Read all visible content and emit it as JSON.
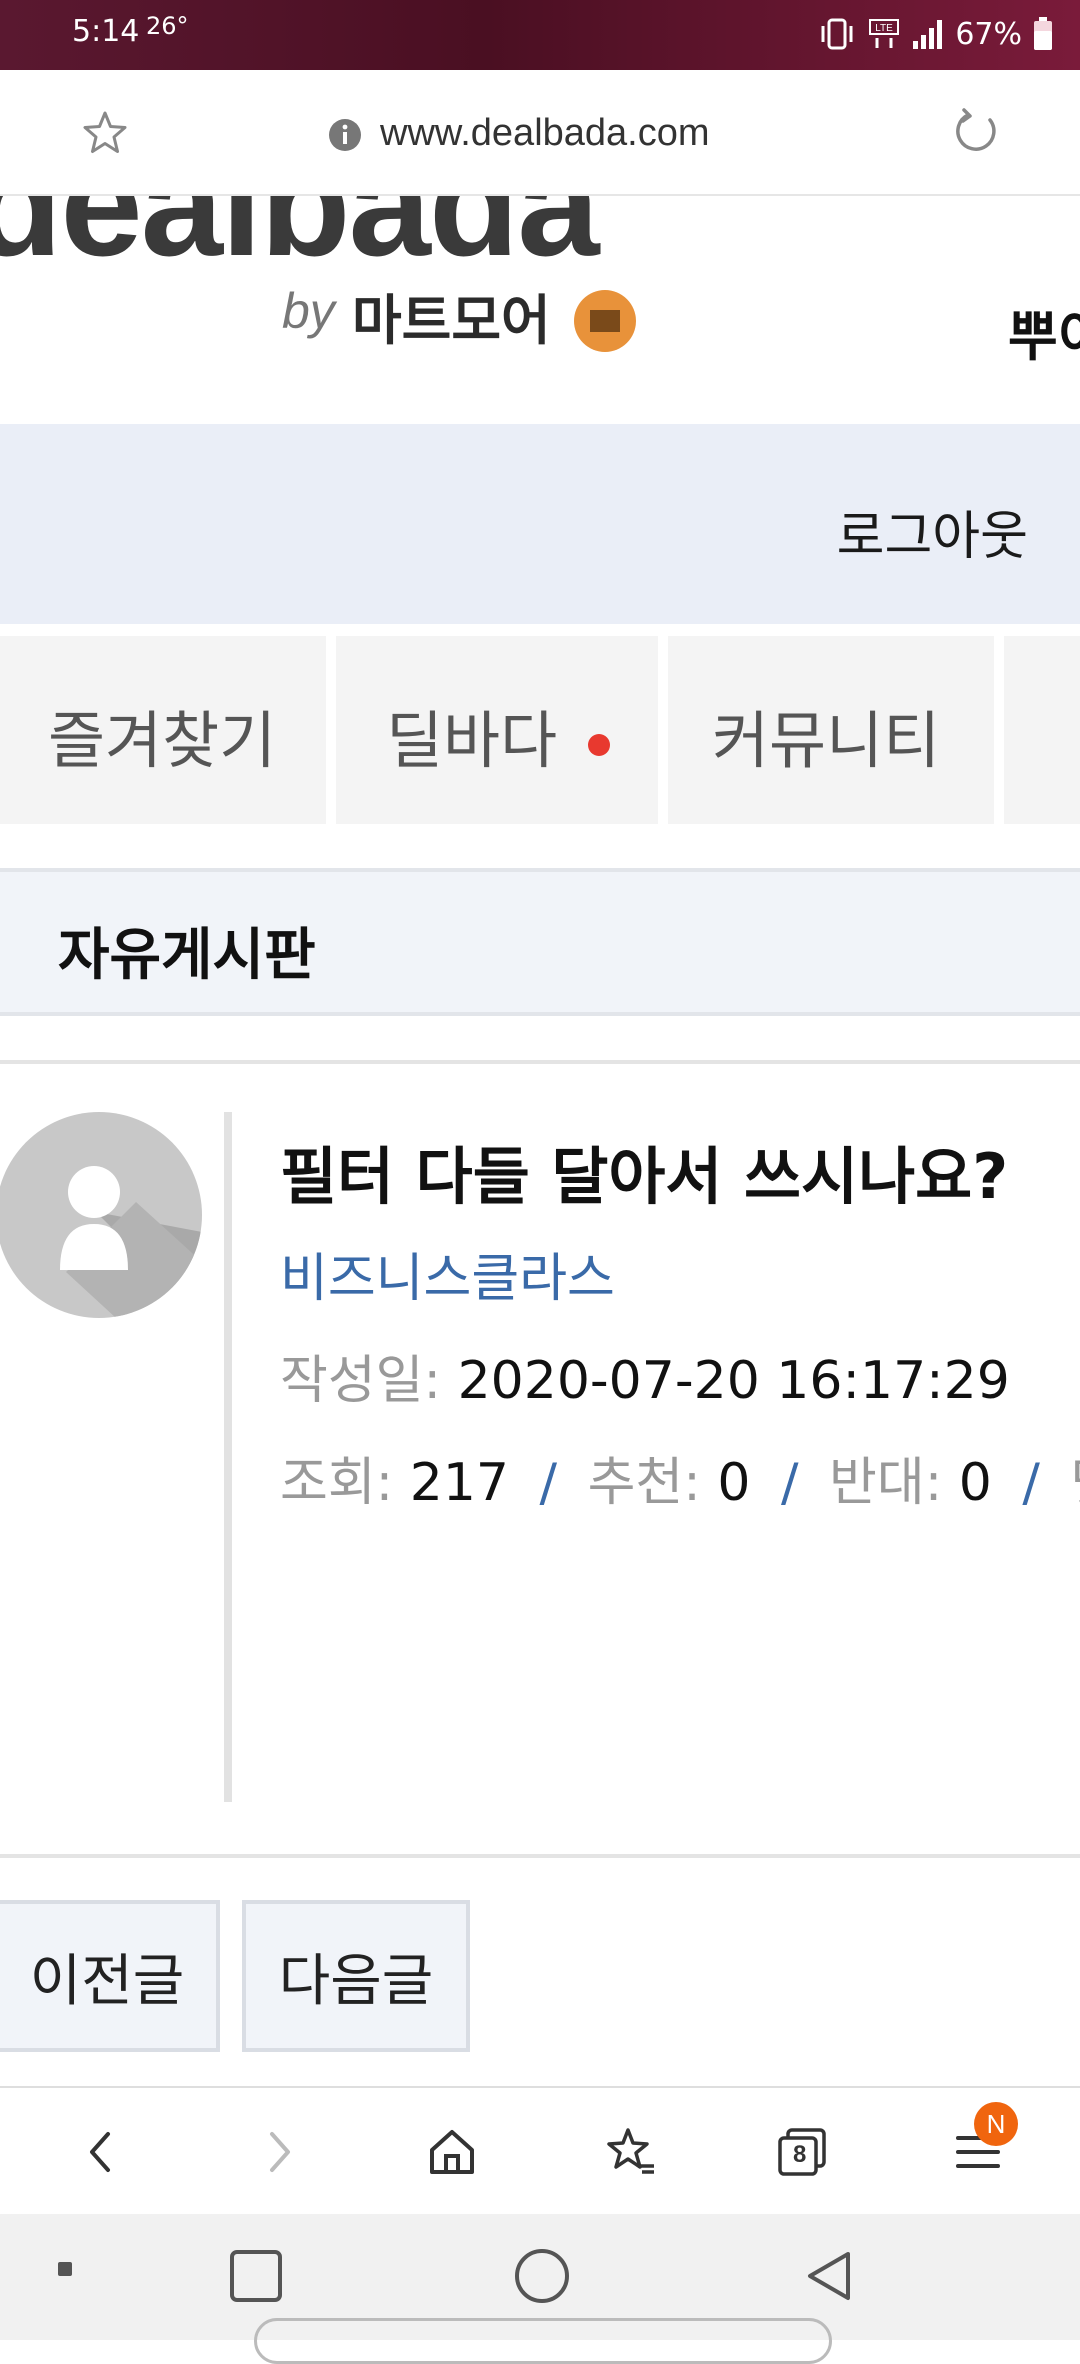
{
  "status_bar": {
    "time": "5:14",
    "temperature": "26°",
    "battery": "67%",
    "icons": [
      "vibrate-icon",
      "lte-icon",
      "signal-icon",
      "battery-icon"
    ]
  },
  "url_bar": {
    "url": "www.dealbada.com",
    "icons": [
      "star-icon",
      "info-icon",
      "reload-icon"
    ]
  },
  "header": {
    "logo_text": "dealbada",
    "logo_by": "by",
    "logo_partner": "마트모어",
    "right_text": "뿌이"
  },
  "account": {
    "logout_label": "로그아웃"
  },
  "nav_tabs": [
    {
      "label": "즐겨찾기"
    },
    {
      "label": "딜바다"
    },
    {
      "label": "커뮤니티"
    }
  ],
  "board": {
    "title": "자유게시판"
  },
  "post": {
    "title": "필터 다들 달아서 쓰시나요?",
    "author": "비즈니스클라스",
    "date_label": "작성일:",
    "date_value": "2020-07-20 16:17:29",
    "views_label": "조회:",
    "views_value": "217",
    "recommend_label": "추천:",
    "recommend_value": "0",
    "oppose_label": "반대:",
    "oppose_value": "0",
    "comments_label": "댓",
    "separator": "/"
  },
  "pager": {
    "prev_label": "이전글",
    "next_label": "다음글"
  },
  "browser_toolbar": {
    "tabs_count": "8",
    "menu_badge": "N",
    "icons": [
      "back-icon",
      "forward-icon",
      "home-icon",
      "bookmarks-icon",
      "tabs-icon",
      "menu-icon"
    ]
  },
  "colors": {
    "status_bar": "#4a0f22",
    "accent_blue": "#3a6aa8",
    "notification_red": "#e8392f",
    "badge_orange": "#f0650e",
    "board_bg": "#f1f4f9"
  }
}
